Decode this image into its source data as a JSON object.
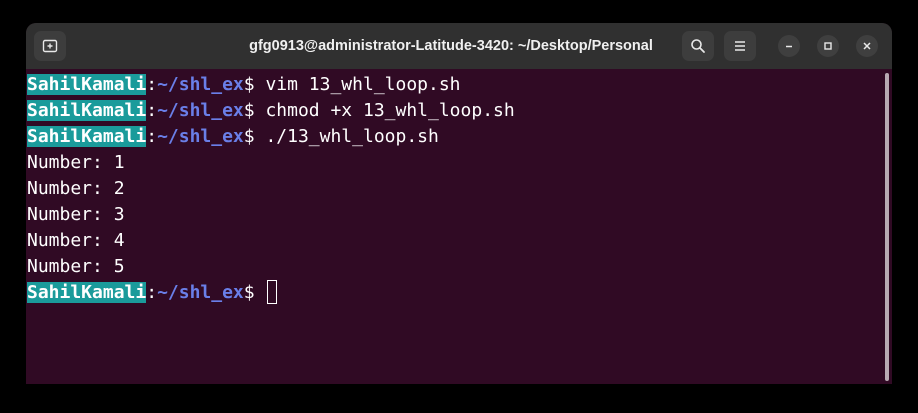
{
  "window": {
    "title": "gfg0913@administrator-Latitude-3420: ~/Desktop/Personal"
  },
  "icons": {
    "new_tab": "new-tab-icon",
    "search": "search-icon",
    "menu": "hamburger-menu-icon",
    "minimize": "minimize-icon",
    "maximize": "maximize-icon",
    "close": "close-icon"
  },
  "colors": {
    "terminal_bg": "#300a24",
    "titlebar_bg": "#303030",
    "user_highlight": "#1a9b9b",
    "path_color": "#6a7fe8",
    "text": "#ffffff"
  },
  "terminal": {
    "lines": [
      {
        "user": "SahilKamali",
        "sep": ":",
        "path": "~/shl_ex",
        "prompt": "$ ",
        "command": "vim 13_whl_loop.sh"
      },
      {
        "user": "SahilKamali",
        "sep": ":",
        "path": "~/shl_ex",
        "prompt": "$ ",
        "command": "chmod +x 13_whl_loop.sh"
      },
      {
        "user": "SahilKamali",
        "sep": ":",
        "path": "~/shl_ex",
        "prompt": "$ ",
        "command": "./13_whl_loop.sh"
      },
      {
        "output": "Number: 1"
      },
      {
        "output": "Number: 2"
      },
      {
        "output": "Number: 3"
      },
      {
        "output": "Number: 4"
      },
      {
        "output": "Number: 5"
      },
      {
        "user": "SahilKamali",
        "sep": ":",
        "path": "~/shl_ex",
        "prompt": "$ ",
        "command": ""
      }
    ]
  }
}
